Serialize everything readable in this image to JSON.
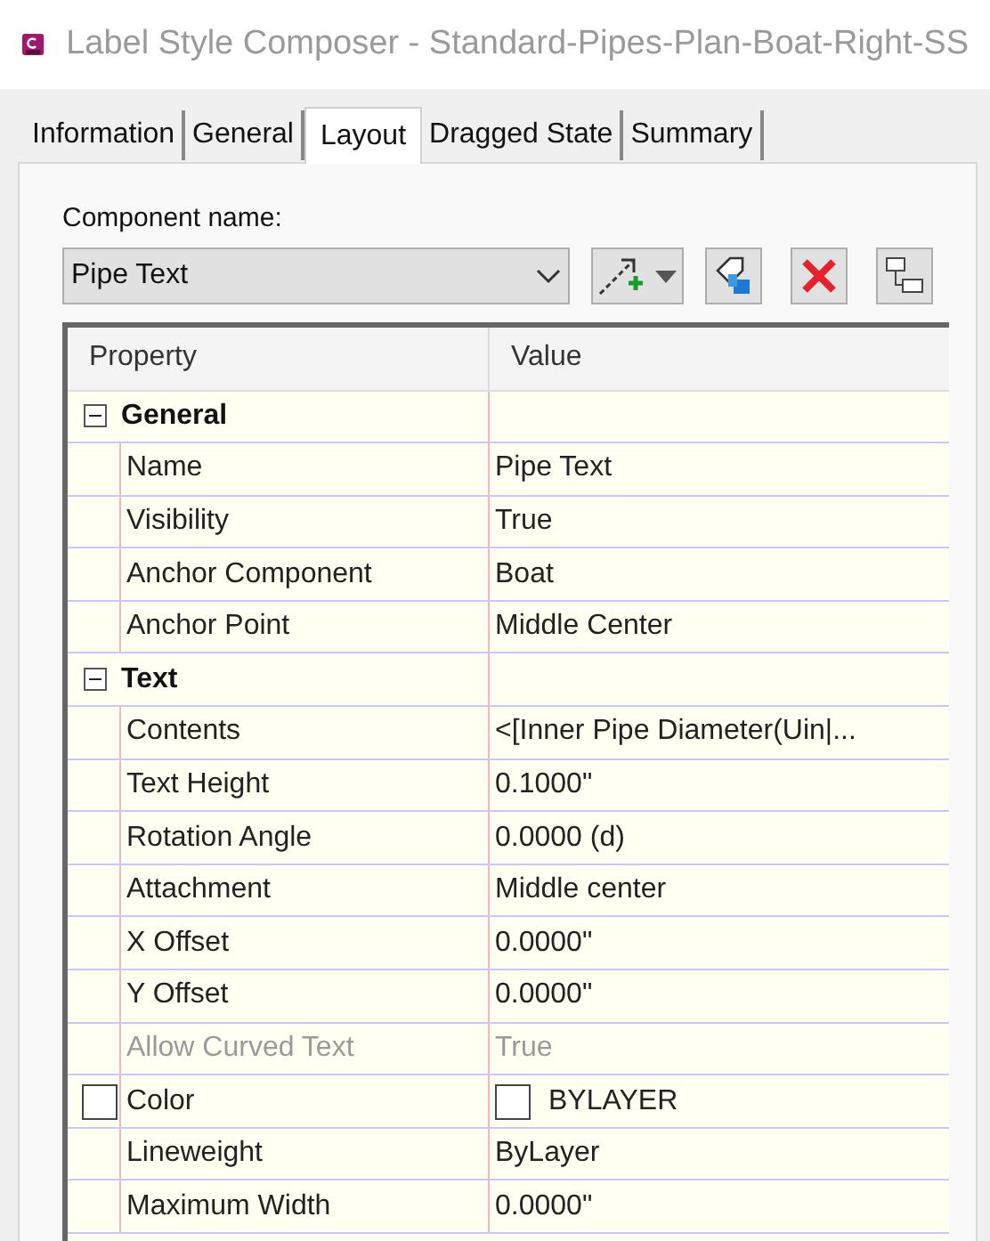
{
  "window": {
    "title": "Label Style Composer - Standard-Pipes-Plan-Boat-Right-SS"
  },
  "tabs": [
    {
      "label": "Information",
      "selected": false
    },
    {
      "label": "General",
      "selected": false
    },
    {
      "label": "Layout",
      "selected": true
    },
    {
      "label": "Dragged State",
      "selected": false
    },
    {
      "label": "Summary",
      "selected": false
    }
  ],
  "component": {
    "label": "Component name:",
    "value": "Pipe Text"
  },
  "table": {
    "columns": [
      "Property",
      "Value"
    ],
    "groups": [
      {
        "name": "General",
        "expanded": true,
        "rows": [
          {
            "kind": "text",
            "property": "Name",
            "value": "Pipe Text",
            "disabled": false
          },
          {
            "kind": "text",
            "property": "Visibility",
            "value": "True",
            "disabled": false
          },
          {
            "kind": "text",
            "property": "Anchor Component",
            "value": "Boat",
            "disabled": false
          },
          {
            "kind": "text",
            "property": "Anchor Point",
            "value": "Middle Center",
            "disabled": false
          }
        ]
      },
      {
        "name": "Text",
        "expanded": true,
        "rows": [
          {
            "kind": "text",
            "property": "Contents",
            "value": "<[Inner Pipe Diameter(Uin|...",
            "disabled": false
          },
          {
            "kind": "text",
            "property": "Text Height",
            "value": "0.1000\"",
            "disabled": false
          },
          {
            "kind": "text",
            "property": "Rotation Angle",
            "value": "0.0000 (d)",
            "disabled": false
          },
          {
            "kind": "text",
            "property": "Attachment",
            "value": "Middle center",
            "disabled": false
          },
          {
            "kind": "text",
            "property": "X Offset",
            "value": "0.0000\"",
            "disabled": false
          },
          {
            "kind": "text",
            "property": "Y Offset",
            "value": "0.0000\"",
            "disabled": false
          },
          {
            "kind": "text",
            "property": "Allow Curved Text",
            "value": "True",
            "disabled": true
          },
          {
            "kind": "color",
            "property": "Color",
            "value": "BYLAYER",
            "disabled": false,
            "color": "#ffffff"
          },
          {
            "kind": "text",
            "property": "Lineweight",
            "value": "ByLayer",
            "disabled": false
          },
          {
            "kind": "text",
            "property": "Maximum Width",
            "value": "0.0000\"",
            "disabled": false
          }
        ]
      }
    ]
  }
}
